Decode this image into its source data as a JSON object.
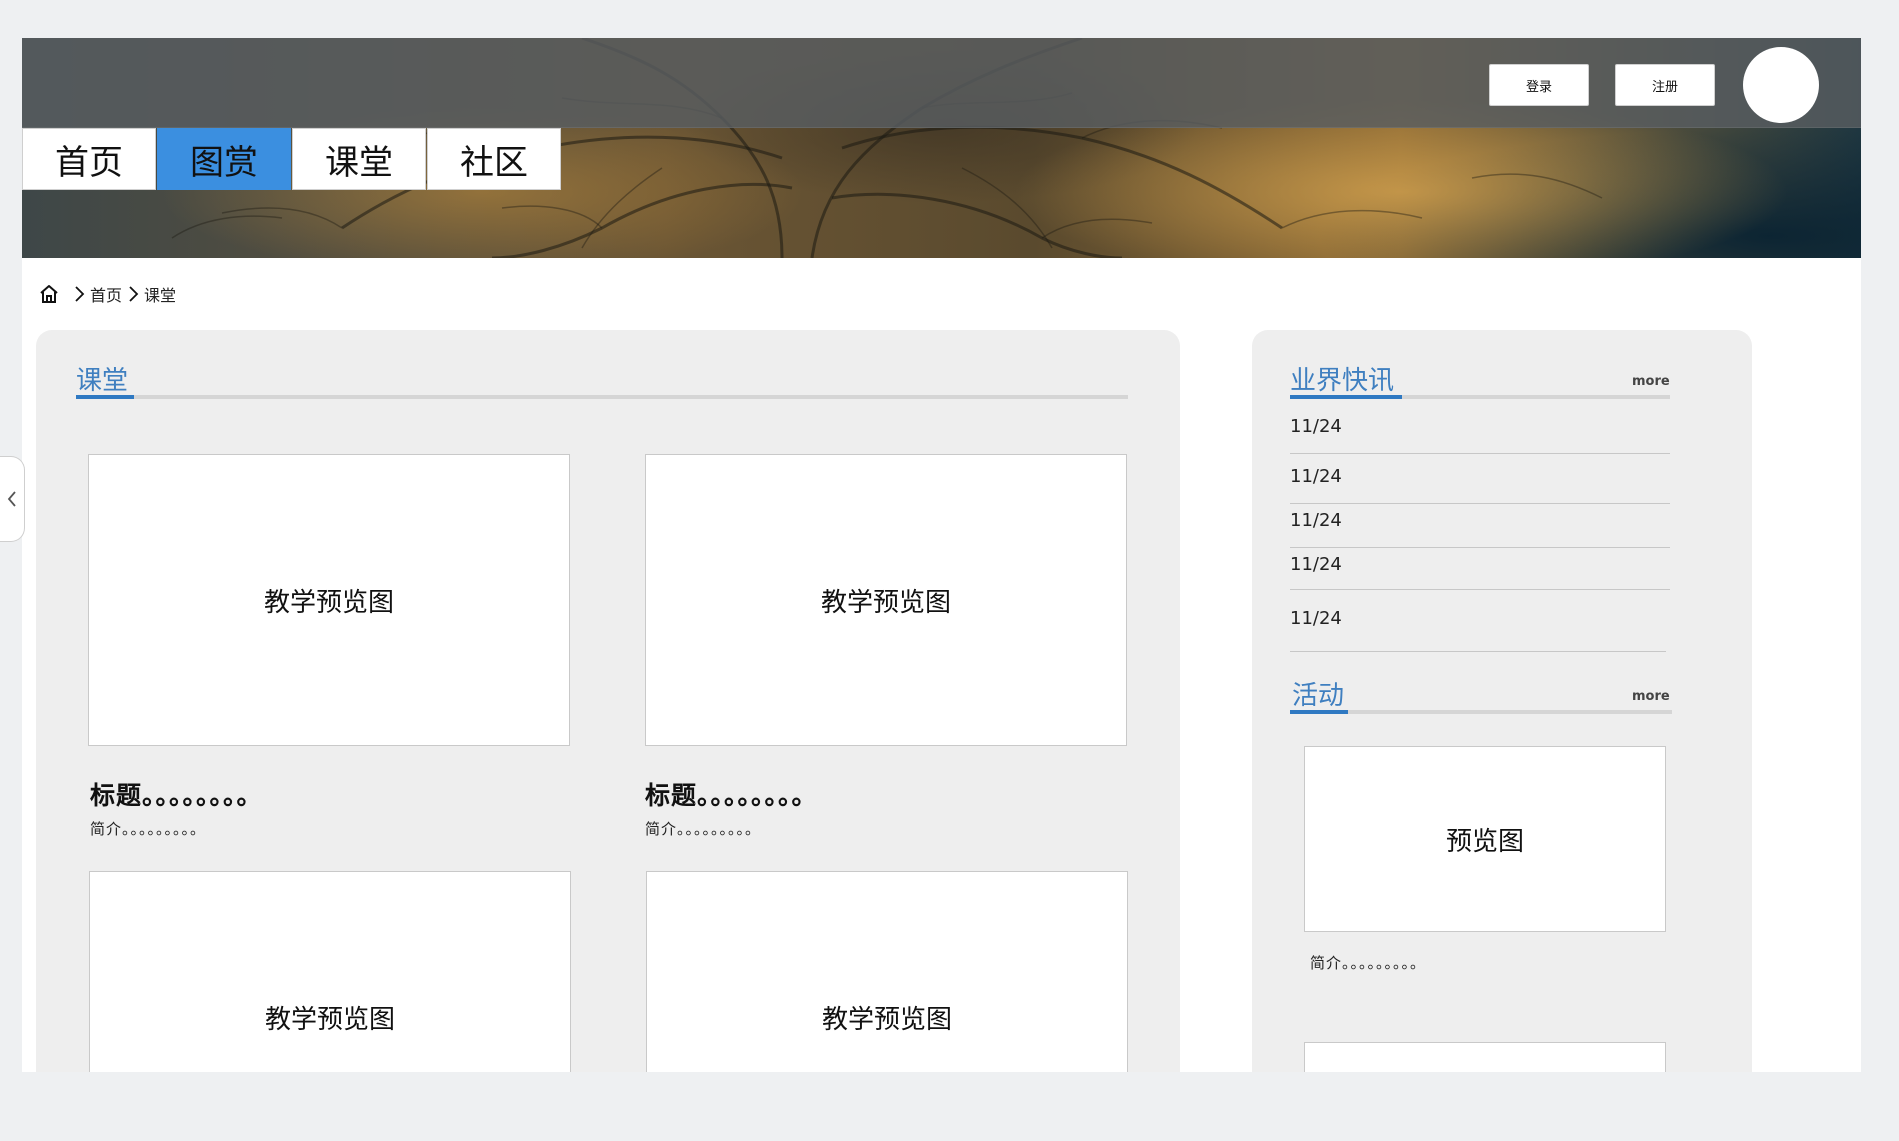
{
  "header": {
    "login_label": "登录",
    "register_label": "注册"
  },
  "nav": {
    "tabs": [
      {
        "label": "首页",
        "active": false
      },
      {
        "label": "图赏",
        "active": true
      },
      {
        "label": "课堂",
        "active": false
      },
      {
        "label": "社区",
        "active": false
      }
    ]
  },
  "breadcrumb": {
    "items": [
      "首页",
      "课堂"
    ]
  },
  "main": {
    "section_title": "课堂",
    "courses": [
      {
        "thumb": "教学预览图",
        "title": "标题。。。。。。。。",
        "intro": "简介。。。。。。。。。"
      },
      {
        "thumb": "教学预览图",
        "title": "标题。。。。。。。。",
        "intro": "简介。。。。。。。。。"
      },
      {
        "thumb": "教学预览图"
      },
      {
        "thumb": "教学预览图"
      }
    ]
  },
  "side": {
    "news_title": "业界快讯",
    "news_more": "more",
    "news_items": [
      "11/24",
      "11/24",
      "11/24",
      "11/24",
      "11/24"
    ],
    "activity_title": "活动",
    "activity_more": "more",
    "activities": [
      {
        "thumb": "预览图",
        "intro": "简介。。。。。。。。。"
      }
    ]
  },
  "colors": {
    "accent": "#3b8fe0",
    "section_title": "#3f7fc0",
    "panel_bg": "#eeeeee",
    "page_bg": "#eef0f2"
  }
}
